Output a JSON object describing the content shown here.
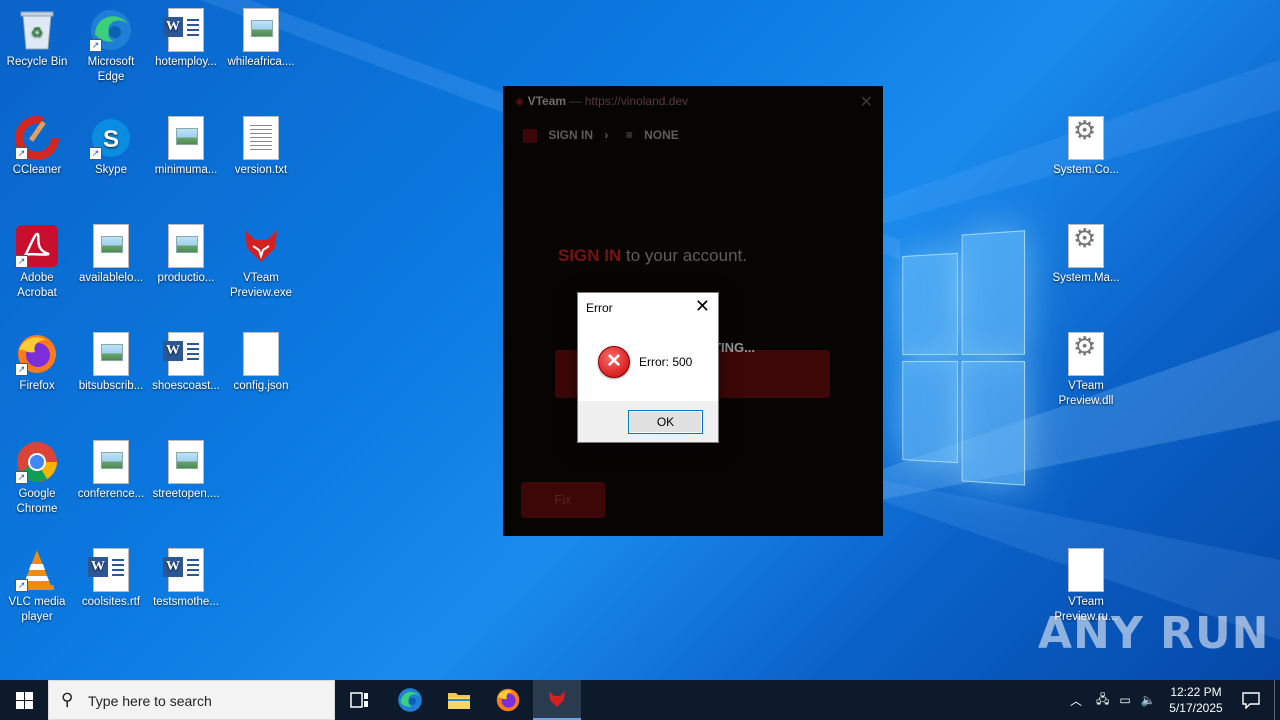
{
  "desktop": {
    "icons": [
      {
        "label": "Recycle Bin"
      },
      {
        "label": "Microsoft Edge"
      },
      {
        "label": "hotemploy..."
      },
      {
        "label": "whileafrica...."
      },
      {
        "label": "CCleaner"
      },
      {
        "label": "Skype"
      },
      {
        "label": "minimuma..."
      },
      {
        "label": "version.txt"
      },
      {
        "label": "Adobe Acrobat"
      },
      {
        "label": "availablelo..."
      },
      {
        "label": "productio..."
      },
      {
        "label": "VTeam Preview.exe"
      },
      {
        "label": "Firefox"
      },
      {
        "label": "bitsubscrib..."
      },
      {
        "label": "shoescoast..."
      },
      {
        "label": "config.json"
      },
      {
        "label": "Google Chrome"
      },
      {
        "label": "conference..."
      },
      {
        "label": "streetopen...."
      },
      {
        "label": "VLC media player"
      },
      {
        "label": "coolsites.rtf"
      },
      {
        "label": "testsmothe..."
      },
      {
        "label": "System.Co..."
      },
      {
        "label": "System.Ma..."
      },
      {
        "label": "VTeam Preview.dll"
      },
      {
        "label": "VTeam Preview.ru..."
      }
    ]
  },
  "vteam_window": {
    "app_name": "VTeam",
    "separator": "—",
    "url": "https://vinoland.dev",
    "close_glyph": "✕",
    "nav_signin": "SIGN IN",
    "nav_arrow": "›",
    "nav_none": "NONE",
    "heading_red": "SIGN IN",
    "heading_rest": "to your account.",
    "button_text": "TING...",
    "fix_label": "Fix"
  },
  "error_dialog": {
    "title": "Error",
    "close_glyph": "✕",
    "message": "Error: 500",
    "ok_label": "OK"
  },
  "taskbar": {
    "search_placeholder": "Type here to search",
    "time": "12:22 PM",
    "date": "5/17/2025"
  },
  "watermark": "ANY RUN"
}
